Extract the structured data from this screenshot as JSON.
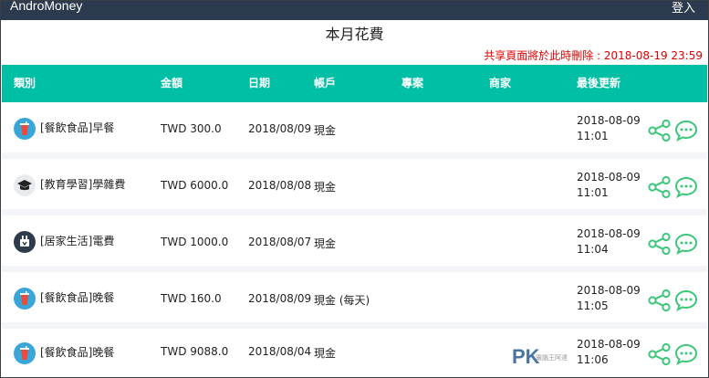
{
  "header": {
    "brand": "AndroMoney",
    "login": "登入"
  },
  "page": {
    "title": "本月花費",
    "notice": "共享頁面將於此時刪除 : 2018-08-19 23:59"
  },
  "table": {
    "columns": [
      "類別",
      "金額",
      "日期",
      "帳戶",
      "專案",
      "商家",
      "最後更新"
    ],
    "rows": [
      {
        "category": "[餐飲食品]早餐",
        "icon": "drink-icon",
        "amount": "TWD 300.0",
        "date": "2018/08/09",
        "account": "現金",
        "project": "",
        "merchant": "",
        "updated_date": "2018-08-09",
        "updated_time": "11:01"
      },
      {
        "category": "[教育學習]學雜費",
        "icon": "graduation-cap-icon",
        "amount": "TWD 6000.0",
        "date": "2018/08/08",
        "account": "現金",
        "project": "",
        "merchant": "",
        "updated_date": "2018-08-09",
        "updated_time": "11:01"
      },
      {
        "category": "[居家生活]電費",
        "icon": "electric-plug-icon",
        "amount": "TWD 1000.0",
        "date": "2018/08/07",
        "account": "現金",
        "project": "",
        "merchant": "",
        "updated_date": "2018-08-09",
        "updated_time": "11:04"
      },
      {
        "category": "[餐飲食品]晚餐",
        "icon": "drink-icon",
        "amount": "TWD 160.0",
        "date": "2018/08/09",
        "account": "現金 (每天)",
        "project": "",
        "merchant": "",
        "updated_date": "2018-08-09",
        "updated_time": "11:05"
      },
      {
        "category": "[餐飲食品]晚餐",
        "icon": "drink-icon",
        "amount": "TWD 9088.0",
        "date": "2018/08/04",
        "account": "現金",
        "project": "",
        "merchant": "",
        "updated_date": "2018-08-09",
        "updated_time": "11:06"
      }
    ]
  },
  "watermark": {
    "text": "PK",
    "sub": "電腦王阿達"
  },
  "colors": {
    "topbar": "#2b3a4e",
    "header_bar": "#00bfa5",
    "notice": "#e00000",
    "action_icons": "#3cc77a"
  }
}
